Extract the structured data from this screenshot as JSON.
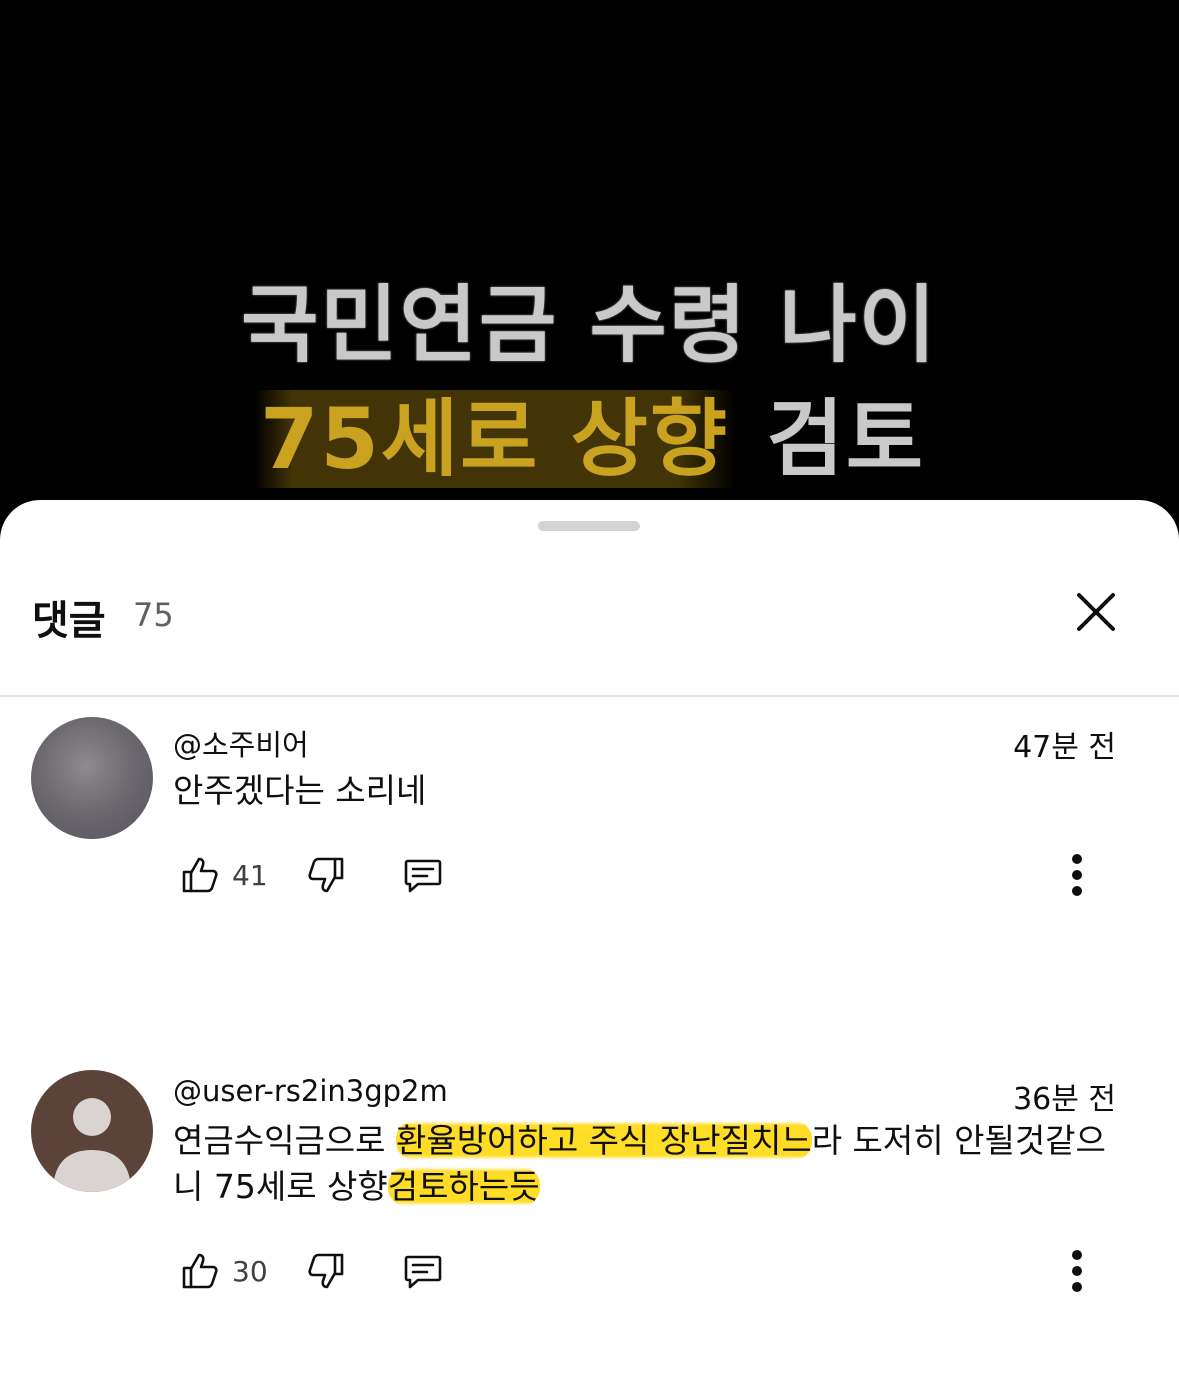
{
  "video": {
    "caption_line1": "국민연금 수령 나이",
    "caption_line2_highlight": "75세로 상향",
    "caption_line2_rest": " 검토",
    "caption_color": "#c9c9c9",
    "highlight_color": "#c9a21f"
  },
  "comments_panel": {
    "title": "댓글",
    "count": "75",
    "close_icon": "close-icon"
  },
  "comments": [
    {
      "author": "@소주비어",
      "time": "47분 전",
      "text": "안주겠다는 소리네",
      "likes": "41",
      "avatar_type": "photo"
    },
    {
      "author": "@user-rs2in3gp2m",
      "time": "36분 전",
      "text_before_marker": "연금수익금으로 ",
      "text_marker": "환율방어하고 주식 장난질치느",
      "text_after_marker": "라 도저히 안될것같으니 75세로 상향",
      "text_marker2": "검토하는듯",
      "likes": "30",
      "avatar_type": "default"
    }
  ],
  "colors": {
    "text_primary": "#0f0f0f",
    "text_secondary": "#606060",
    "marker_yellow": "#ffd600",
    "avatar_default_bg": "#5b4339"
  }
}
